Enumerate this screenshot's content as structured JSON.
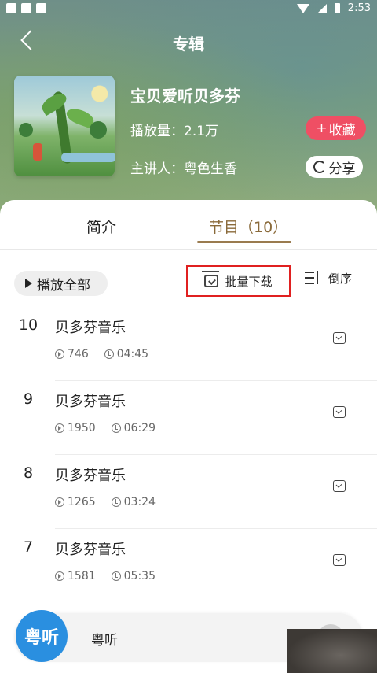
{
  "status_bar": {
    "time": "2:53"
  },
  "header": {
    "title": "专辑"
  },
  "album": {
    "title": "宝贝爱听贝多芬",
    "play_count": "播放量：2.1万",
    "speaker": "主讲人：粤色生香",
    "favorite_label": "收藏",
    "share_label": "分享"
  },
  "tabs": {
    "intro": "简介",
    "programs": "节目（10）",
    "active": "programs"
  },
  "toolbar": {
    "play_all": "播放全部",
    "batch_download": "批量下载",
    "reverse": "倒序"
  },
  "tracks": [
    {
      "index": "10",
      "title": "贝多芬音乐",
      "plays": "746",
      "duration": "04:45"
    },
    {
      "index": "9",
      "title": "贝多芬音乐",
      "plays": "1950",
      "duration": "06:29"
    },
    {
      "index": "8",
      "title": "贝多芬音乐",
      "plays": "1265",
      "duration": "03:24"
    },
    {
      "index": "7",
      "title": "贝多芬音乐",
      "plays": "1581",
      "duration": "05:35"
    }
  ],
  "mini_player": {
    "logo_text": "粤听",
    "title": "粤听"
  },
  "colors": {
    "accent": "#9a7b4f",
    "favorite": "#ef4f64",
    "highlight_box": "#e02020",
    "logo_blue": "#2a8fe0"
  }
}
